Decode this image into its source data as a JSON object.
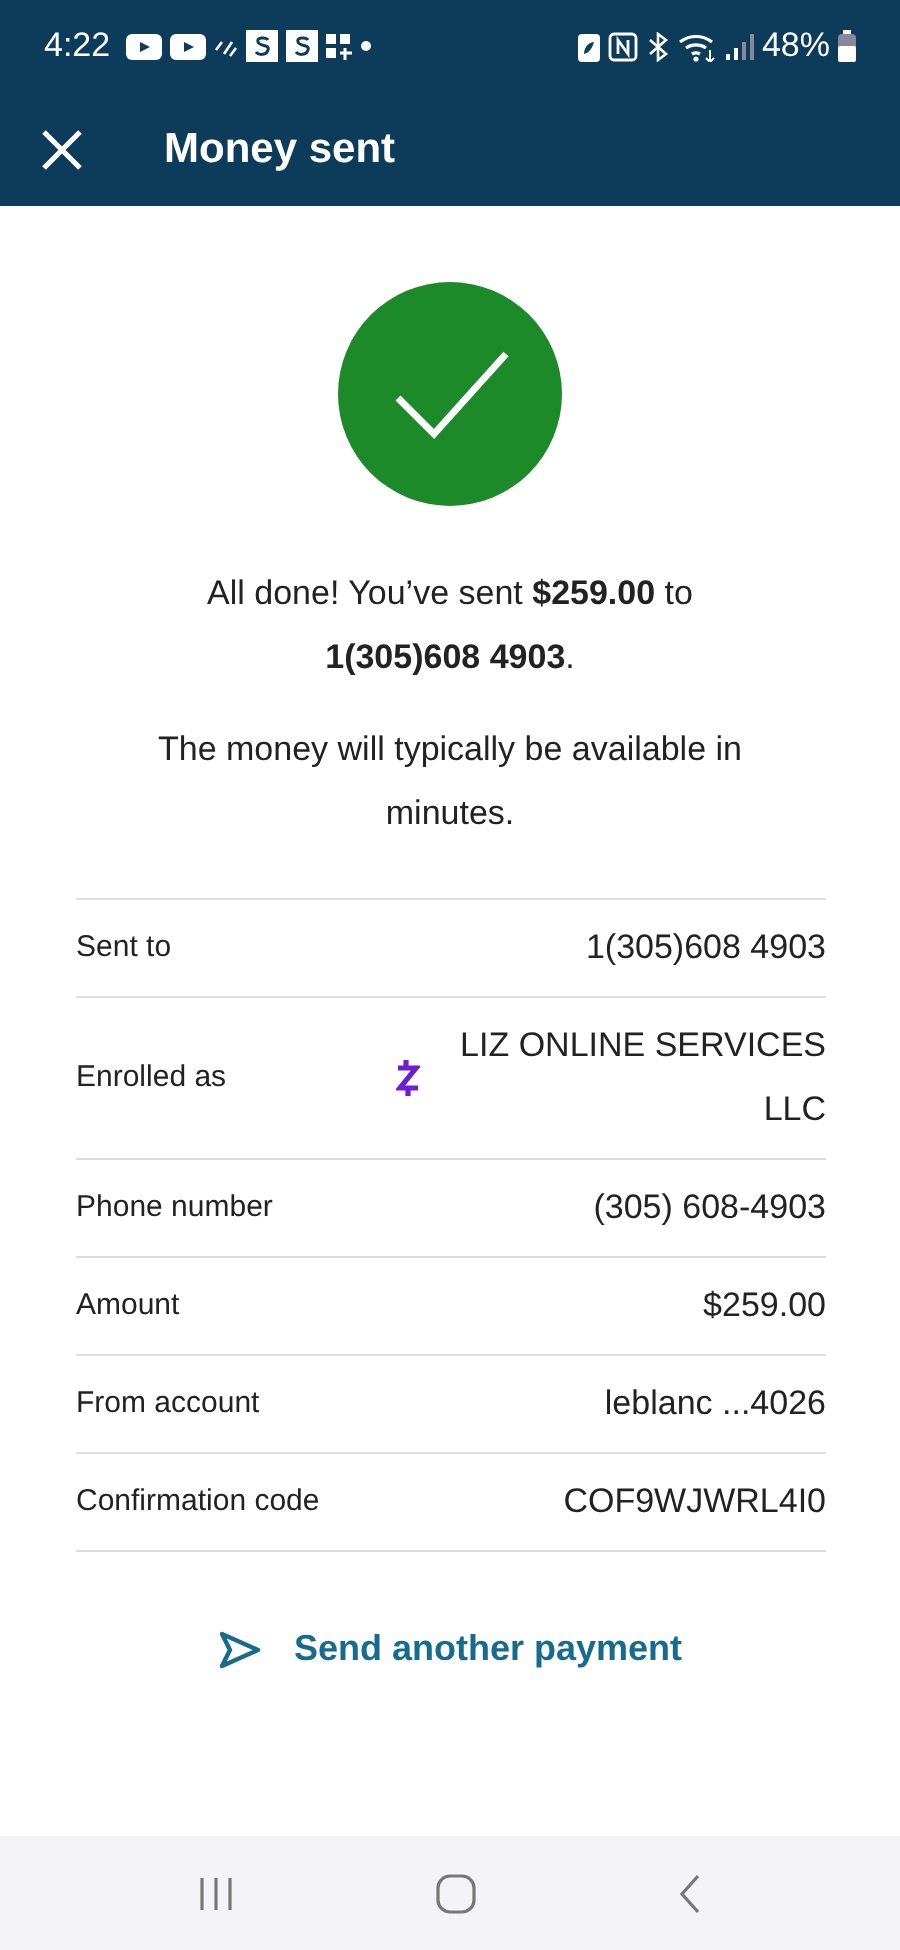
{
  "status_bar": {
    "time": "4:22",
    "battery": "48%"
  },
  "header": {
    "title": "Money sent"
  },
  "message": "All done! You’ve sent **$259.00** to **1(305)608 4903**.",
  "note": "The money will typically be available in minutes.",
  "details": [
    {
      "kind": "text",
      "label": "Sent to",
      "value": "1(305)608 4903"
    },
    {
      "kind": "zelle",
      "label": "Enrolled as",
      "value": "LIZ ONLINE SERVICES LLC"
    },
    {
      "kind": "text",
      "label": "Phone number",
      "value": "(305) 608-4903"
    },
    {
      "kind": "text",
      "label": "Amount",
      "value": "$259.00"
    },
    {
      "kind": "text",
      "label": "From account",
      "value": "leblanc ...4026"
    },
    {
      "kind": "text",
      "label": "Confirmation code",
      "value": "COF9WJWRL4I0"
    }
  ],
  "action": {
    "label": "Send another payment"
  }
}
